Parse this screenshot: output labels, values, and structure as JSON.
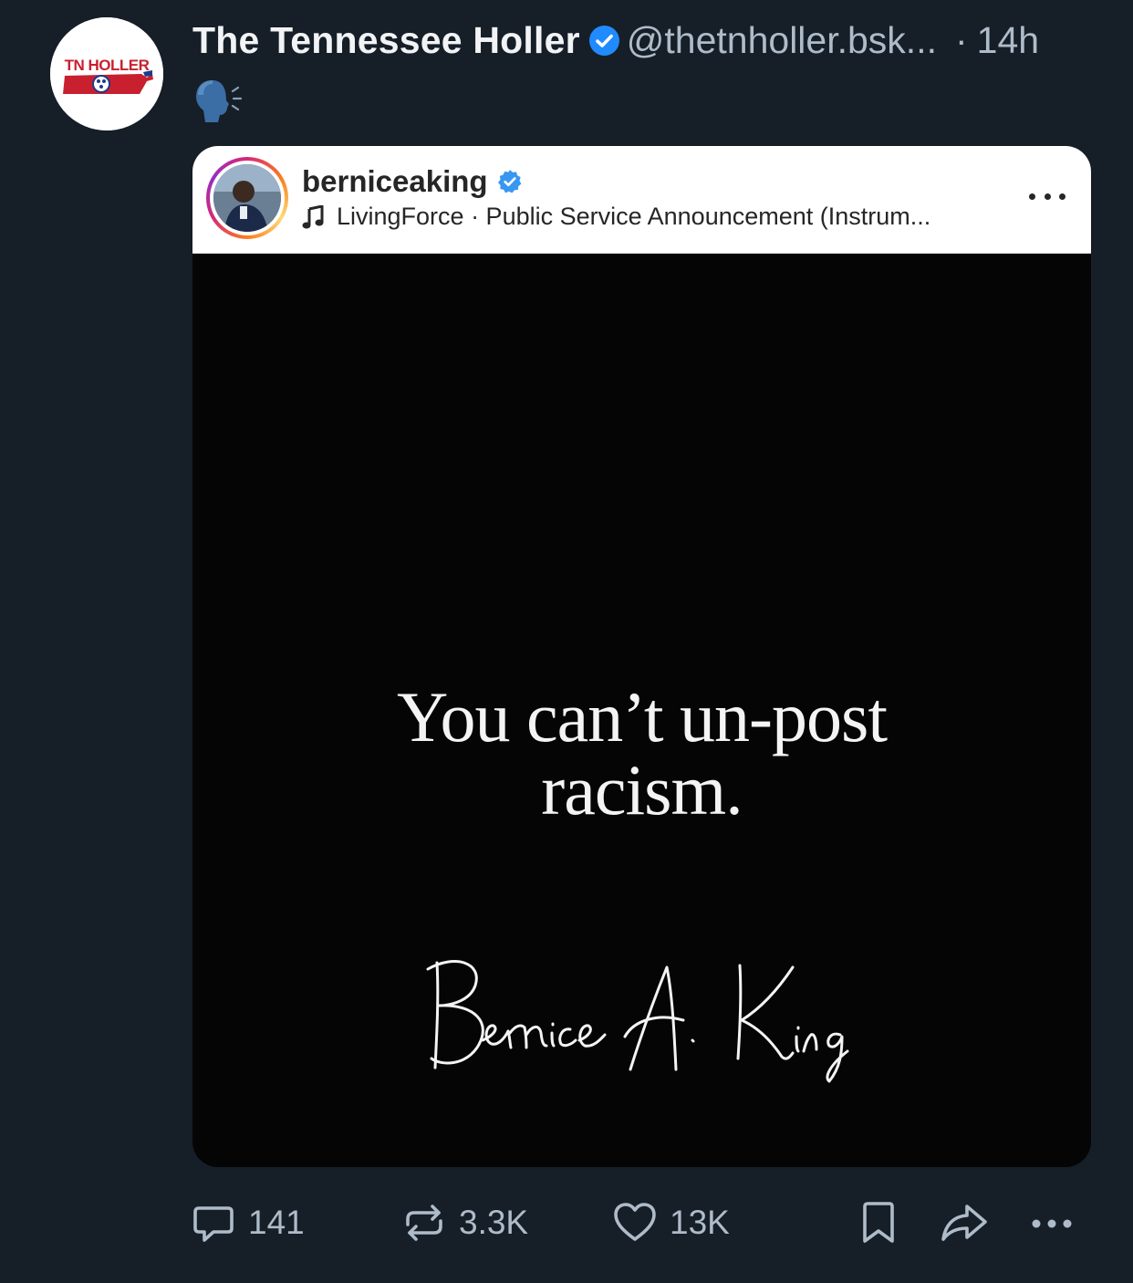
{
  "post": {
    "author": {
      "display_name": "The Tennessee Holler",
      "handle": "@thetnholler.bsk...",
      "avatar_logo_text": "TN HOLLER"
    },
    "separator": "·",
    "timestamp": "14h",
    "body_emoji": "🗣️",
    "embed": {
      "username": "berniceaking",
      "audio": "LivingForce · Public Service Announcement (Instrum...",
      "quote_line1": "You can’t un-post",
      "quote_line2": "racism.",
      "signature": "Bernice A. King"
    },
    "actions": {
      "reply_count": "141",
      "repost_count": "3.3K",
      "like_count": "13K"
    }
  },
  "colors": {
    "background": "#161e27",
    "muted_text": "#aebbc9",
    "verified_blue": "#208bfe",
    "ig_verified_blue": "#3897f0"
  }
}
